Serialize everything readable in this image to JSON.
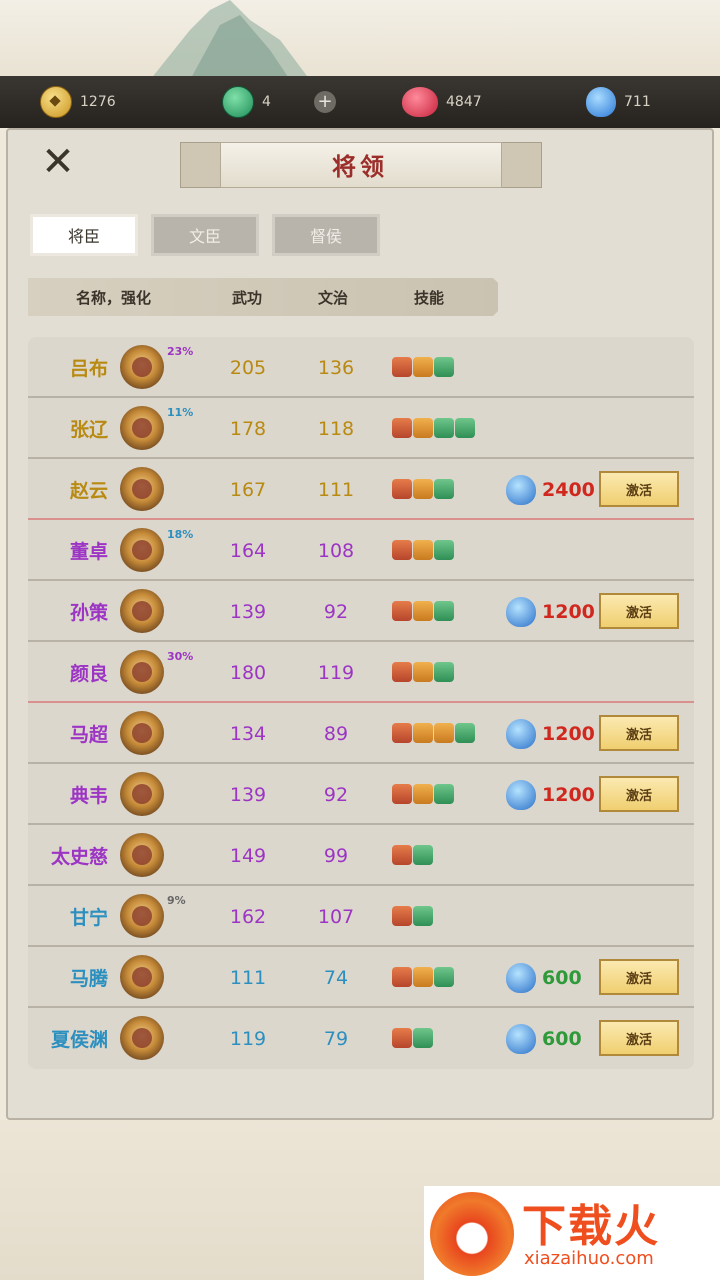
{
  "resources": {
    "gold": "1276",
    "jade": "4",
    "red_gem": "4847",
    "blue_gem": "711"
  },
  "title": "将领",
  "tabs": [
    {
      "label": "将臣",
      "active": true
    },
    {
      "label": "文臣",
      "active": false
    },
    {
      "label": "督侯",
      "active": false
    }
  ],
  "columns": {
    "name": "名称，强化",
    "wu": "武功",
    "wen": "文治",
    "skill": "技能"
  },
  "activate_label": "激活",
  "rows": [
    {
      "name": "吕布",
      "pct": "23%",
      "wu": "205",
      "wen": "136",
      "cost": ""
    },
    {
      "name": "张辽",
      "pct": "11%",
      "wu": "178",
      "wen": "118",
      "cost": ""
    },
    {
      "name": "赵云",
      "pct": "",
      "wu": "167",
      "wen": "111",
      "cost": "2400"
    },
    {
      "name": "董卓",
      "pct": "18%",
      "wu": "164",
      "wen": "108",
      "cost": ""
    },
    {
      "name": "孙策",
      "pct": "",
      "wu": "139",
      "wen": "92",
      "cost": "1200"
    },
    {
      "name": "颜良",
      "pct": "30%",
      "wu": "180",
      "wen": "119",
      "cost": ""
    },
    {
      "name": "马超",
      "pct": "",
      "wu": "134",
      "wen": "89",
      "cost": "1200"
    },
    {
      "name": "典韦",
      "pct": "",
      "wu": "139",
      "wen": "92",
      "cost": "1200"
    },
    {
      "name": "太史慈",
      "pct": "",
      "wu": "149",
      "wen": "99",
      "cost": ""
    },
    {
      "name": "甘宁",
      "pct": "9%",
      "wu": "162",
      "wen": "107",
      "cost": ""
    },
    {
      "name": "马腾",
      "pct": "",
      "wu": "111",
      "wen": "74",
      "cost": "600"
    },
    {
      "name": "夏侯渊",
      "pct": "",
      "wu": "119",
      "wen": "79",
      "cost": "600"
    }
  ],
  "watermark": {
    "cn": "下载火",
    "en": "xiazaihuo.com"
  }
}
